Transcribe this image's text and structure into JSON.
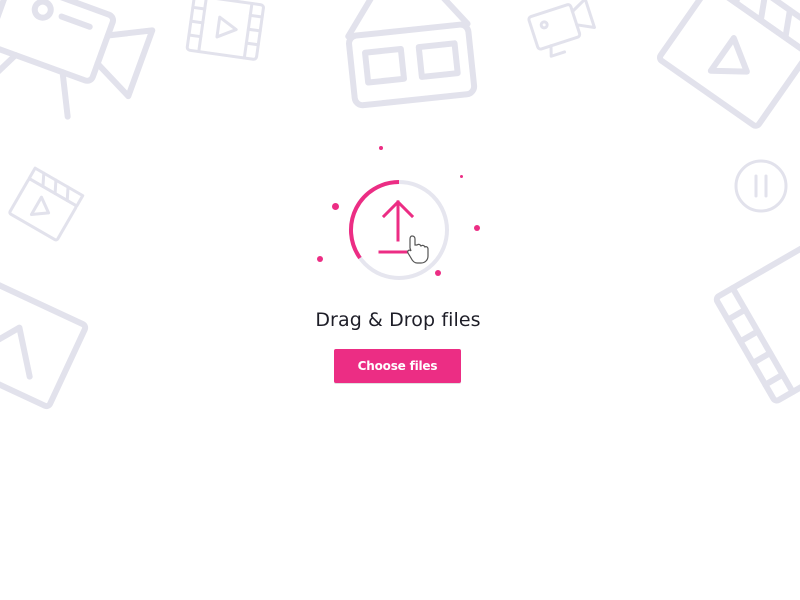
{
  "drop_zone": {
    "title": "Drag & Drop files",
    "upload_icon": "upload-arrow-icon",
    "cursor_icon": "hand-pointer-icon"
  },
  "actions": {
    "choose_label": "Choose files"
  },
  "background": {
    "icons": [
      "video-camera-icon",
      "film-strip-icon",
      "vr-headset-icon",
      "camera-icon",
      "clapperboard-icon",
      "pause-icon",
      "picture-icon"
    ]
  },
  "colors": {
    "accent": "#ec2d84",
    "background_icon": "#e2e2ec",
    "ring_track": "#e6e6ef",
    "text": "#1e1e28"
  }
}
